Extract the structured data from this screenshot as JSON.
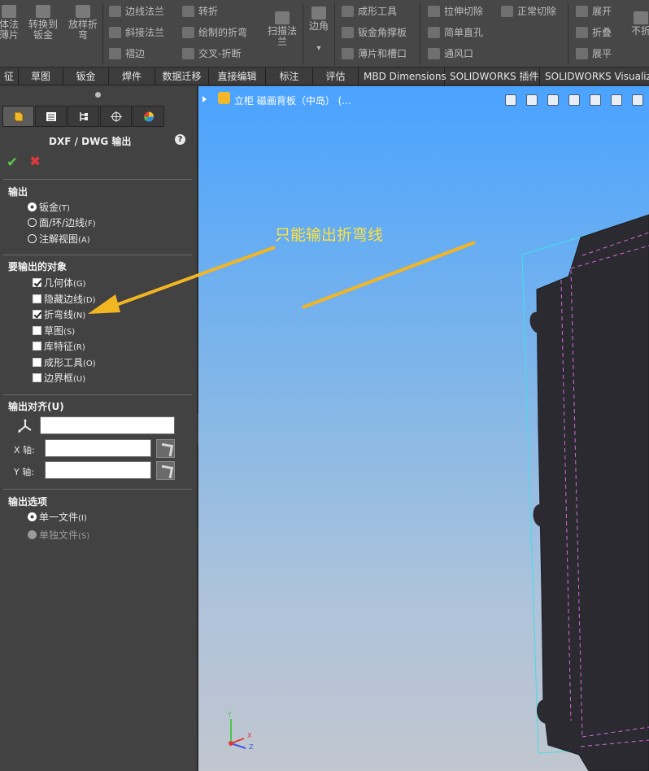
{
  "ribbon": {
    "big_buttons": [
      {
        "line1": "体法",
        "line2": "薄片",
        "icon": "base-flange-icon"
      },
      {
        "line1": "转换到",
        "line2": "钣金",
        "icon": "convert-to-sheetmetal-icon"
      },
      {
        "line1": "放样折",
        "line2": "弯",
        "icon": "lofted-bend-icon"
      },
      {
        "line1": "扫描法",
        "line2": "兰",
        "icon": "swept-flange-icon"
      },
      {
        "line1": "边角",
        "line2": "",
        "icon": "corners-icon"
      },
      {
        "line1": "不折",
        "line2": "",
        "icon": "no-bends-icon"
      }
    ],
    "col1": [
      {
        "label": "边线法兰",
        "icon": "edge-flange-icon"
      },
      {
        "label": "斜接法兰",
        "icon": "miter-flange-icon"
      },
      {
        "label": "褶边",
        "icon": "hem-icon"
      }
    ],
    "col2": [
      {
        "label": "转折",
        "icon": "jog-icon"
      },
      {
        "label": "绘制的折弯",
        "icon": "sketched-bend-icon"
      },
      {
        "label": "交叉-折断",
        "icon": "cross-break-icon"
      }
    ],
    "col3": [
      {
        "label": "成形工具",
        "icon": "forming-tool-icon"
      },
      {
        "label": "钣金角撑板",
        "icon": "gusset-icon"
      },
      {
        "label": "薄片和槽口",
        "icon": "tab-slot-icon"
      }
    ],
    "col4": [
      {
        "label": "拉伸切除",
        "icon": "extruded-cut-icon"
      },
      {
        "label": "简单直孔",
        "icon": "simple-hole-icon"
      },
      {
        "label": "通风口",
        "icon": "vent-icon"
      }
    ],
    "col4b": [
      {
        "label": "正常切除",
        "icon": "normal-cut-icon"
      }
    ],
    "col5": [
      {
        "label": "展开",
        "icon": "unfold-icon"
      },
      {
        "label": "折叠",
        "icon": "fold-icon"
      },
      {
        "label": "展平",
        "icon": "flatten-icon"
      }
    ],
    "dropdown_arrow": "▾"
  },
  "tabs": [
    {
      "label": "征"
    },
    {
      "label": "草图"
    },
    {
      "label": "钣金"
    },
    {
      "label": "焊件"
    },
    {
      "label": "数据迁移"
    },
    {
      "label": "直接编辑"
    },
    {
      "label": "标注"
    },
    {
      "label": "评估"
    },
    {
      "label": "MBD Dimensions"
    },
    {
      "label": "SOLIDWORKS 插件"
    },
    {
      "label": "SOLIDWORKS Visualize"
    }
  ],
  "panel": {
    "title": "DXF / DWG 输出",
    "help": "?",
    "ok": "✔",
    "cancel": "✖",
    "output": {
      "heading": "输出",
      "options": [
        {
          "label": "钣金",
          "key": "T"
        },
        {
          "label": "面/环/边线",
          "key": "F"
        },
        {
          "label": "注解视图",
          "key": "A"
        }
      ]
    },
    "entities": {
      "heading": "要输出的对象",
      "items": [
        {
          "label": "几何体",
          "key": "G"
        },
        {
          "label": "隐藏边线",
          "key": "D"
        },
        {
          "label": "折弯线",
          "key": "N"
        },
        {
          "label": "草图",
          "key": "S"
        },
        {
          "label": "库特征",
          "key": "R"
        },
        {
          "label": "成形工具",
          "key": "O"
        },
        {
          "label": "边界框",
          "key": "U"
        }
      ]
    },
    "align": {
      "heading": "输出对齐",
      "heading_key": "U",
      "origin_value": "",
      "x_label": "X 轴:",
      "x_value": "",
      "y_label": "Y 轴:",
      "y_value": ""
    },
    "export_options": {
      "heading": "输出选项",
      "options": [
        {
          "label": "单一文件",
          "key": "I"
        },
        {
          "label": "单独文件",
          "key": "S"
        }
      ]
    }
  },
  "viewport": {
    "tree_text": "立柜 磁画背板（中岛）   (...",
    "annotation": "只能输出折弯线",
    "triad": {
      "x": "X",
      "y": "Y",
      "z": "Z"
    },
    "colors": {
      "annotation": "#ffe23d",
      "part": "#2b2a31",
      "bend_line": "#d16bd9",
      "bbox": "#42e0e8"
    }
  }
}
